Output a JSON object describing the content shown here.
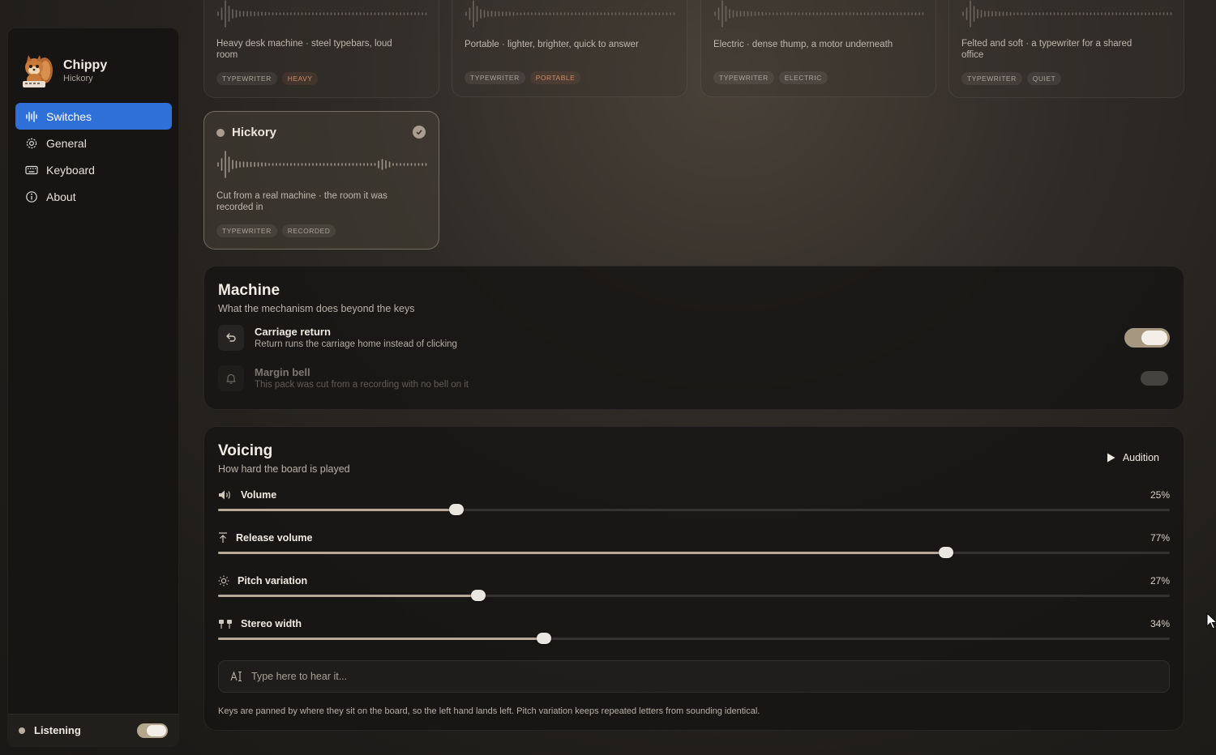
{
  "app": {
    "name": "Chippy",
    "current_pack": "Hickory"
  },
  "sidebar": {
    "items": [
      {
        "label": "Switches",
        "icon": "waveform-icon",
        "active": true
      },
      {
        "label": "General",
        "icon": "gear-icon",
        "active": false
      },
      {
        "label": "Keyboard",
        "icon": "keyboard-icon",
        "active": false
      },
      {
        "label": "About",
        "icon": "info-icon",
        "active": false
      }
    ],
    "listening": {
      "label": "Listening",
      "on": true
    }
  },
  "packs": [
    {
      "desc": "Heavy desk machine · steel typebars, loud room",
      "tags": [
        "TYPEWRITER",
        "HEAVY"
      ]
    },
    {
      "desc": "Portable · lighter, brighter, quick to answer",
      "tags": [
        "TYPEWRITER",
        "PORTABLE"
      ]
    },
    {
      "desc": "Electric · dense thump, a motor underneath",
      "tags": [
        "TYPEWRITER",
        "ELECTRIC"
      ]
    },
    {
      "desc": "Felted and soft · a typewriter for a shared office",
      "tags": [
        "TYPEWRITER",
        "QUIET"
      ]
    },
    {
      "name": "Hickory",
      "desc": "Cut from a real machine · the room it was recorded in",
      "tags": [
        "TYPEWRITER",
        "RECORDED"
      ],
      "selected": true
    }
  ],
  "machine": {
    "title": "Machine",
    "subtitle": "What the mechanism does beyond the keys",
    "options": [
      {
        "title": "Carriage return",
        "desc": "Return runs the carriage home instead of clicking",
        "on": true,
        "enabled": true
      },
      {
        "title": "Margin bell",
        "desc": "This pack was cut from a recording with no bell on it",
        "on": false,
        "enabled": false
      }
    ]
  },
  "voicing": {
    "title": "Voicing",
    "subtitle": "How hard the board is played",
    "audition_label": "Audition",
    "sliders": [
      {
        "label": "Volume",
        "value_text": "25%",
        "position": 0.25
      },
      {
        "label": "Release volume",
        "value_text": "77%",
        "position": 0.765
      },
      {
        "label": "Pitch variation",
        "value_text": "27%",
        "position": 0.273
      },
      {
        "label": "Stereo width",
        "value_text": "34%",
        "position": 0.342
      }
    ],
    "type_placeholder": "Type here to hear it...",
    "footnote": "Keys are panned by where they sit on the board, so the left hand lands left. Pitch variation keeps repeated letters from sounding identical."
  },
  "colors": {
    "accent": "#2f6fd8",
    "tag_accent": "#d18a67",
    "toggle_on": "#a59780"
  }
}
